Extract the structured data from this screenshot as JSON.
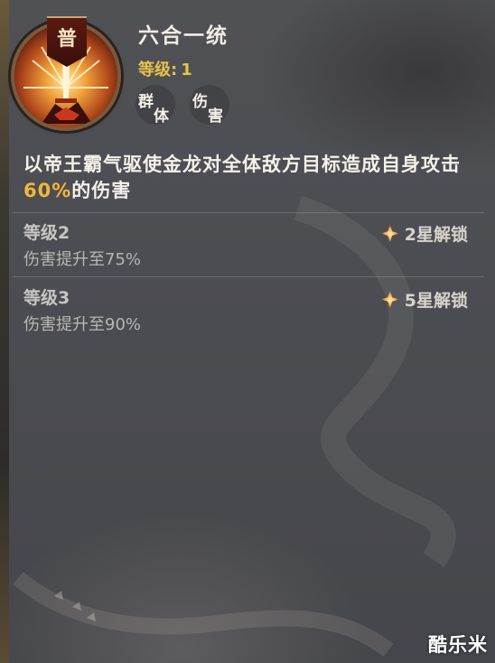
{
  "skill": {
    "badge_char": "普",
    "name": "六合一统",
    "level_label": "等级:",
    "level_value": "1",
    "tags": [
      {
        "c1": "群",
        "c2": "体"
      },
      {
        "c1": "伤",
        "c2": "害"
      }
    ],
    "description_before": "以帝王霸气驱使金龙对全体敌方目标造成自身攻击",
    "description_highlight": "60%",
    "description_after": "的伤害"
  },
  "upgrades": [
    {
      "title": "等级2",
      "effect": "伤害提升至75%",
      "unlock": "2星解锁"
    },
    {
      "title": "等级3",
      "effect": "伤害提升至90%",
      "unlock": "5星解锁"
    }
  ],
  "watermark": "酷乐米",
  "colors": {
    "highlight": "#f2b63c",
    "level_text": "#e8c24a",
    "panel_bg": "#4d4e53"
  },
  "icons": {
    "skill_icon": "golden-sword-burst-icon",
    "unlock_icon": "star-sparkle-icon"
  }
}
